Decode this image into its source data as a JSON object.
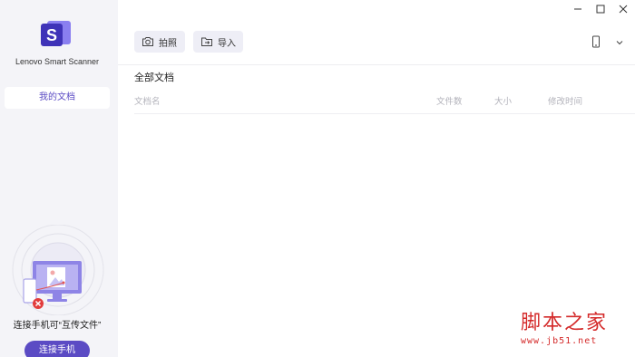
{
  "app": {
    "name": "Lenovo Smart Scanner",
    "accent_color": "#5b4bc4"
  },
  "sidebar": {
    "items": [
      {
        "label": "我的文档",
        "icon": "none",
        "selected": true
      }
    ],
    "connect": {
      "hint": "连接手机可“互传文件”",
      "button_label": "连接手机",
      "illustration_icon": "phone-monitor-transfer-illustration"
    }
  },
  "titlebar": {
    "controls": [
      "minimize-icon",
      "maximize-icon",
      "close-icon"
    ]
  },
  "toolbar": {
    "capture_label": "拍照",
    "capture_icon": "camera-icon",
    "import_label": "导入",
    "import_icon": "folder-import-icon",
    "device_icon": "phone-device-icon",
    "dropdown_icon": "chevron-down-icon"
  },
  "main": {
    "section_title": "全部文档",
    "columns": [
      "文档名",
      "文件数",
      "大小",
      "修改时间"
    ],
    "rows": []
  },
  "watermark": {
    "text": "脚本之家",
    "url": "www.jb51.net"
  }
}
